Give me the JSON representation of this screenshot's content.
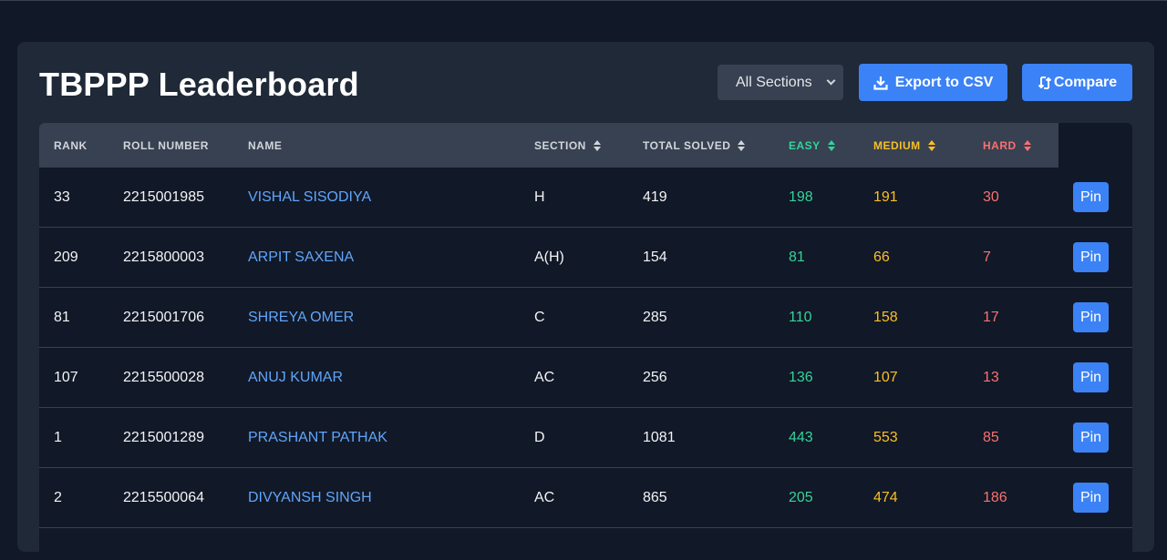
{
  "header": {
    "title": "TBPPP Leaderboard",
    "section_filter": {
      "selected": "All Sections"
    },
    "export_label": "Export to CSV",
    "compare_label": "Compare"
  },
  "table": {
    "columns": {
      "rank": "RANK",
      "roll": "ROLL NUMBER",
      "name": "NAME",
      "section": "SECTION",
      "total": "TOTAL SOLVED",
      "easy": "EASY",
      "medium": "MEDIUM",
      "hard": "HARD"
    },
    "pin_label": "Pin",
    "rows": [
      {
        "rank": "33",
        "roll": "2215001985",
        "name": "VISHAL SISODIYA",
        "section": "H",
        "total": "419",
        "easy": "198",
        "medium": "191",
        "hard": "30"
      },
      {
        "rank": "209",
        "roll": "2215800003",
        "name": "ARPIT SAXENA",
        "section": "A(H)",
        "total": "154",
        "easy": "81",
        "medium": "66",
        "hard": "7"
      },
      {
        "rank": "81",
        "roll": "2215001706",
        "name": "SHREYA OMER",
        "section": "C",
        "total": "285",
        "easy": "110",
        "medium": "158",
        "hard": "17"
      },
      {
        "rank": "107",
        "roll": "2215500028",
        "name": "ANUJ KUMAR",
        "section": "AC",
        "total": "256",
        "easy": "136",
        "medium": "107",
        "hard": "13"
      },
      {
        "rank": "1",
        "roll": "2215001289",
        "name": "PRASHANT PATHAK",
        "section": "D",
        "total": "1081",
        "easy": "443",
        "medium": "553",
        "hard": "85"
      },
      {
        "rank": "2",
        "roll": "2215500064",
        "name": "DIVYANSH SINGH",
        "section": "AC",
        "total": "865",
        "easy": "205",
        "medium": "474",
        "hard": "186"
      }
    ]
  },
  "colors": {
    "accent": "#3b82f6",
    "easy": "#34d399",
    "medium": "#fbbf24",
    "hard": "#f87171",
    "link": "#60a5fa"
  },
  "icons": {
    "export": "download-icon",
    "compare": "compare-arrows-icon",
    "sort": "sort-icon"
  }
}
